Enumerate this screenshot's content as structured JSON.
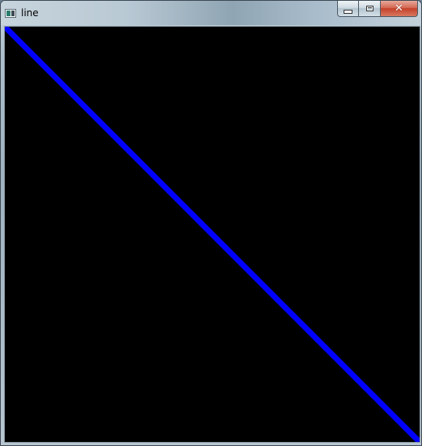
{
  "window": {
    "title": "line",
    "close_glyph": "✕",
    "icons": {
      "app": "app-icon",
      "minimize": "minimize-icon",
      "maximize": "maximize-icon",
      "close": "close-icon"
    }
  },
  "image": {
    "background": "#000000",
    "line_color": "#0000ff",
    "shape": "diagonal line from top-left corner to bottom-right corner"
  }
}
